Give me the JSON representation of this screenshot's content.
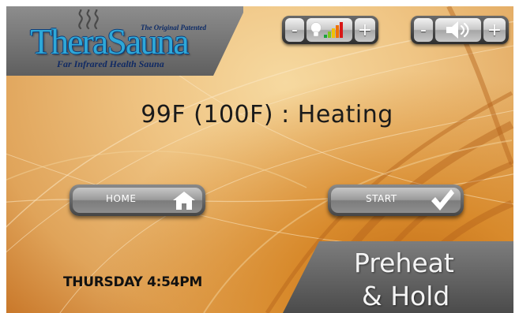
{
  "logo": {
    "tagline": "The Original Patented",
    "brand": "TheraSauna",
    "sub": "Far Infrared Health Sauna"
  },
  "light_control": {
    "minus_label": "-",
    "plus_label": "+",
    "icon": "lightbulb-icon",
    "level_icon": "color-level-bars-icon"
  },
  "volume_control": {
    "minus_label": "-",
    "plus_label": "+",
    "icon": "speaker-icon"
  },
  "status": {
    "text": "99F (100F) : Heating"
  },
  "buttons": {
    "home_label": "HOME",
    "home_icon": "house-icon",
    "start_label": "START",
    "start_icon": "checkmark-icon"
  },
  "datetime": "THURSDAY 4:54PM",
  "mode": {
    "line1": "Preheat",
    "line2": "& Hold"
  },
  "colors": {
    "background_light": "#f6d9a0",
    "background_dark": "#c06a14",
    "panel_gray": "#5f5f5f",
    "logo_blue": "#2ea8d8",
    "logo_navy": "#102a64"
  }
}
